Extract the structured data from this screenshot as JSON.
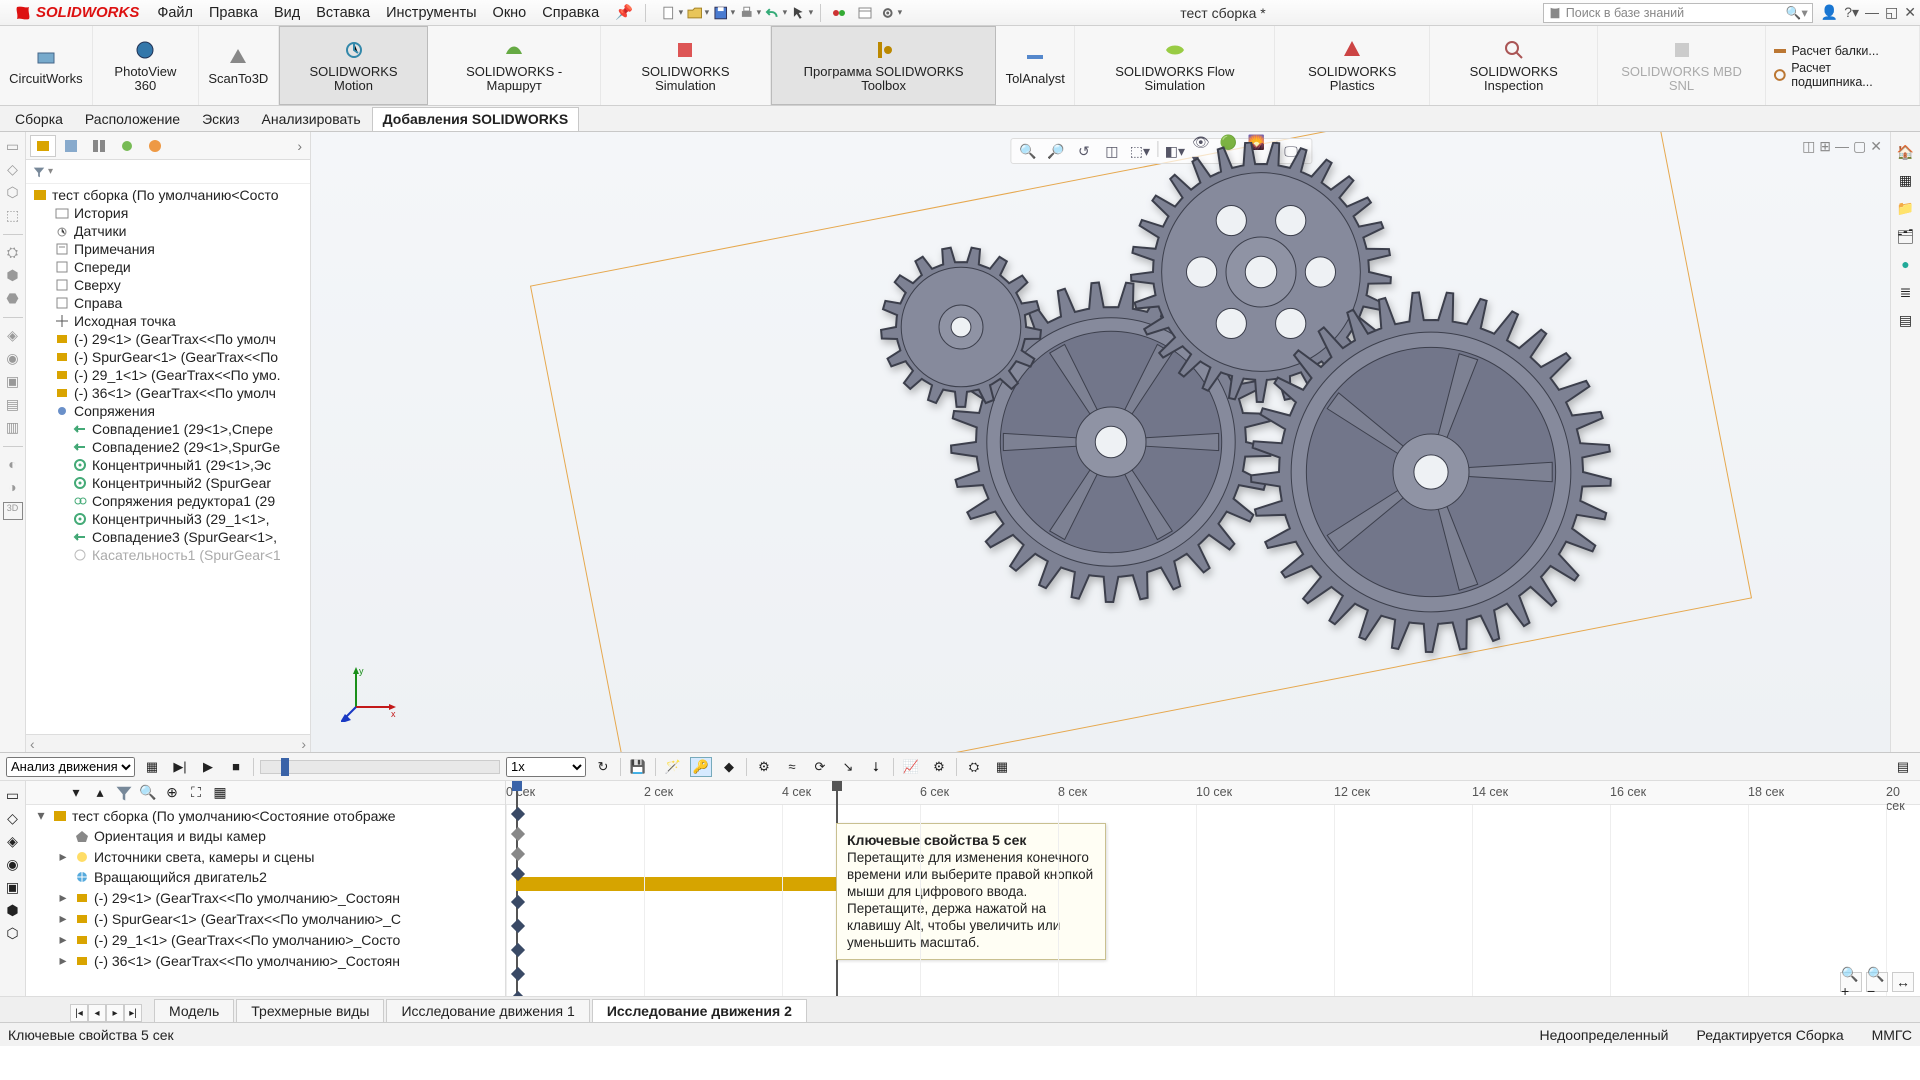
{
  "app": {
    "brand": "SOLIDWORKS",
    "doc_title": "тест сборка *"
  },
  "menu": {
    "file": "Файл",
    "edit": "Правка",
    "view": "Вид",
    "insert": "Вставка",
    "tools": "Инструменты",
    "window": "Окно",
    "help": "Справка"
  },
  "search": {
    "placeholder": "Поиск в базе знаний"
  },
  "ribbon": {
    "circuitworks": "CircuitWorks",
    "photoview": "PhotoView 360",
    "scanto3d": "ScanTo3D",
    "motion": "SOLIDWORKS Motion",
    "routing": "SOLIDWORKS - Маршрут",
    "simulation": "SOLIDWORKS Simulation",
    "toolbox": "Программа SOLIDWORKS Toolbox",
    "tolanalyst": "TolAnalyst",
    "flow": "SOLIDWORKS Flow Simulation",
    "plastics": "SOLIDWORKS Plastics",
    "inspection": "SOLIDWORKS Inspection",
    "mbd": "SOLIDWORKS MBD SNL",
    "beam": "Расчет балки...",
    "bearing": "Расчет подшипника..."
  },
  "tabs": {
    "assembly": "Сборка",
    "layout": "Расположение",
    "sketch": "Эскиз",
    "analyze": "Анализировать",
    "addins": "Добавления SOLIDWORKS"
  },
  "tree": {
    "root": "тест сборка  (По умолчанию<Состо",
    "history": "История",
    "sensors": "Датчики",
    "notes": "Примечания",
    "front": "Спереди",
    "top": "Сверху",
    "right": "Справа",
    "origin": "Исходная точка",
    "p1": "(-) 29<1> (GearTrax<<По умолч",
    "p2": "(-) SpurGear<1> (GearTrax<<По",
    "p3": "(-) 29_1<1> (GearTrax<<По умо.",
    "p4": "(-) 36<1> (GearTrax<<По умолч",
    "mates": "Сопряжения",
    "m1": "Совпадение1 (29<1>,Спере",
    "m2": "Совпадение2 (29<1>,SpurGe",
    "m3": "Концентричный1 (29<1>,Эс",
    "m4": "Концентричный2 (SpurGear",
    "m5": "Сопряжения редуктора1 (29",
    "m6": "Концентричный3 (29_1<1>,",
    "m7": "Совпадение3 (SpurGear<1>,",
    "m8": "Касательность1 (SpurGear<1"
  },
  "motion": {
    "study_type": "Анализ движения",
    "root": "тест сборка  (По умолчанию<Состояние отображе",
    "cam": "Ориентация и виды камер",
    "lights": "Источники света, камеры и сцены",
    "motor": "Вращающийся двигатель2",
    "g1": "(-) 29<1> (GearTrax<<По умолчанию>_Состоян",
    "g2": "(-) SpurGear<1> (GearTrax<<По умолчанию>_С",
    "g3": "(-) 29_1<1> (GearTrax<<По умолчанию>_Состо",
    "g4": "(-) 36<1> (GearTrax<<По умолчанию>_Состоян"
  },
  "timeline": {
    "ticks": [
      "0 сек",
      "2 сек",
      "4 сек",
      "6 сек",
      "8 сек",
      "10 сек",
      "12 сек",
      "14 сек",
      "16 сек",
      "18 сек",
      "20 сек"
    ],
    "tooltip_title": "Ключевые свойства 5 сек",
    "tooltip_body": "Перетащите для изменения конечного времени или выберите правой кнопкой мыши для цифрового ввода. Перетащите, держа нажатой на клавишу Alt, чтобы увеличить или уменьшить масштаб."
  },
  "viewtabs": {
    "model": "Модель",
    "threeD": "Трехмерные виды",
    "study1": "Исследование движения 1",
    "study2": "Исследование движения 2"
  },
  "status": {
    "msg": "Ключевые свойства 5 сек",
    "under": "Недоопределенный",
    "editing": "Редактируется Сборка",
    "units": "ММГС"
  }
}
